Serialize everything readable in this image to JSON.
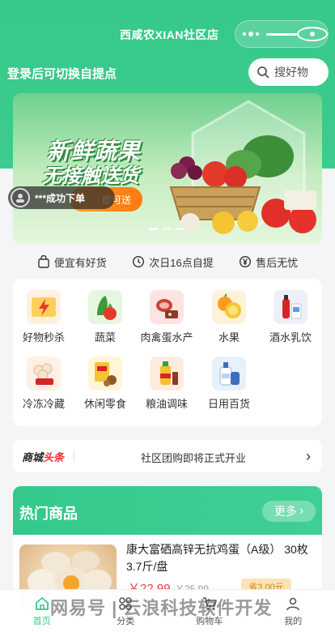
{
  "nav": {
    "title": "西咸农XIAN社区店"
  },
  "header": {
    "login_tip": "登录后可切换自提点",
    "search_placeholder": "搜好物"
  },
  "banner": {
    "line1": "新鲜蔬果",
    "line2": "无接触送货",
    "button_label": "即可送",
    "toast_text": "***成功下单"
  },
  "features": [
    {
      "label": "便宜有好货",
      "icon": "bag-icon"
    },
    {
      "label": "次日16点自提",
      "icon": "clock-icon"
    },
    {
      "label": "售后无忧",
      "icon": "yen-icon"
    }
  ],
  "categories": [
    {
      "label": "好物秒杀",
      "icon": "flash-sale-icon",
      "color": "#fff0e0"
    },
    {
      "label": "蔬菜",
      "icon": "vegetable-icon",
      "color": "#e6f7e0"
    },
    {
      "label": "肉禽蛋水产",
      "icon": "meat-icon",
      "color": "#fde4e2"
    },
    {
      "label": "水果",
      "icon": "fruit-icon",
      "color": "#fff2d8"
    },
    {
      "label": "酒水乳饮",
      "icon": "drinks-icon",
      "color": "#eef0f8"
    },
    {
      "label": "冷冻冷藏",
      "icon": "frozen-icon",
      "color": "#fdf0e4"
    },
    {
      "label": "休闲零食",
      "icon": "snack-icon",
      "color": "#fff6d8"
    },
    {
      "label": "粮油调味",
      "icon": "oil-icon",
      "color": "#fdece0"
    },
    {
      "label": "日用百货",
      "icon": "daily-goods-icon",
      "color": "#e6f1fb"
    }
  ],
  "headline": {
    "brand_prefix": "商城",
    "brand_suffix": "头条",
    "text": "社区团购即将正式开业"
  },
  "hot": {
    "title": "热门商品",
    "more_label": "更多",
    "product": {
      "name": "康大富硒高锌无抗鸡蛋（A级） 30枚3.7斤/盘",
      "price": "￥22.99",
      "old_price": "￥25.99",
      "tag": "省3.00元"
    }
  },
  "tabbar": [
    {
      "label": "首页",
      "icon": "home-icon",
      "active": true
    },
    {
      "label": "分类",
      "icon": "category-icon",
      "active": false
    },
    {
      "label": "购物车",
      "icon": "cart-icon",
      "active": false
    },
    {
      "label": "我的",
      "icon": "user-icon",
      "active": false
    }
  ],
  "watermark": "网易号 | 云浪科技软件开发",
  "colors": {
    "brand": "#35c98a",
    "price": "#f03c3c"
  }
}
